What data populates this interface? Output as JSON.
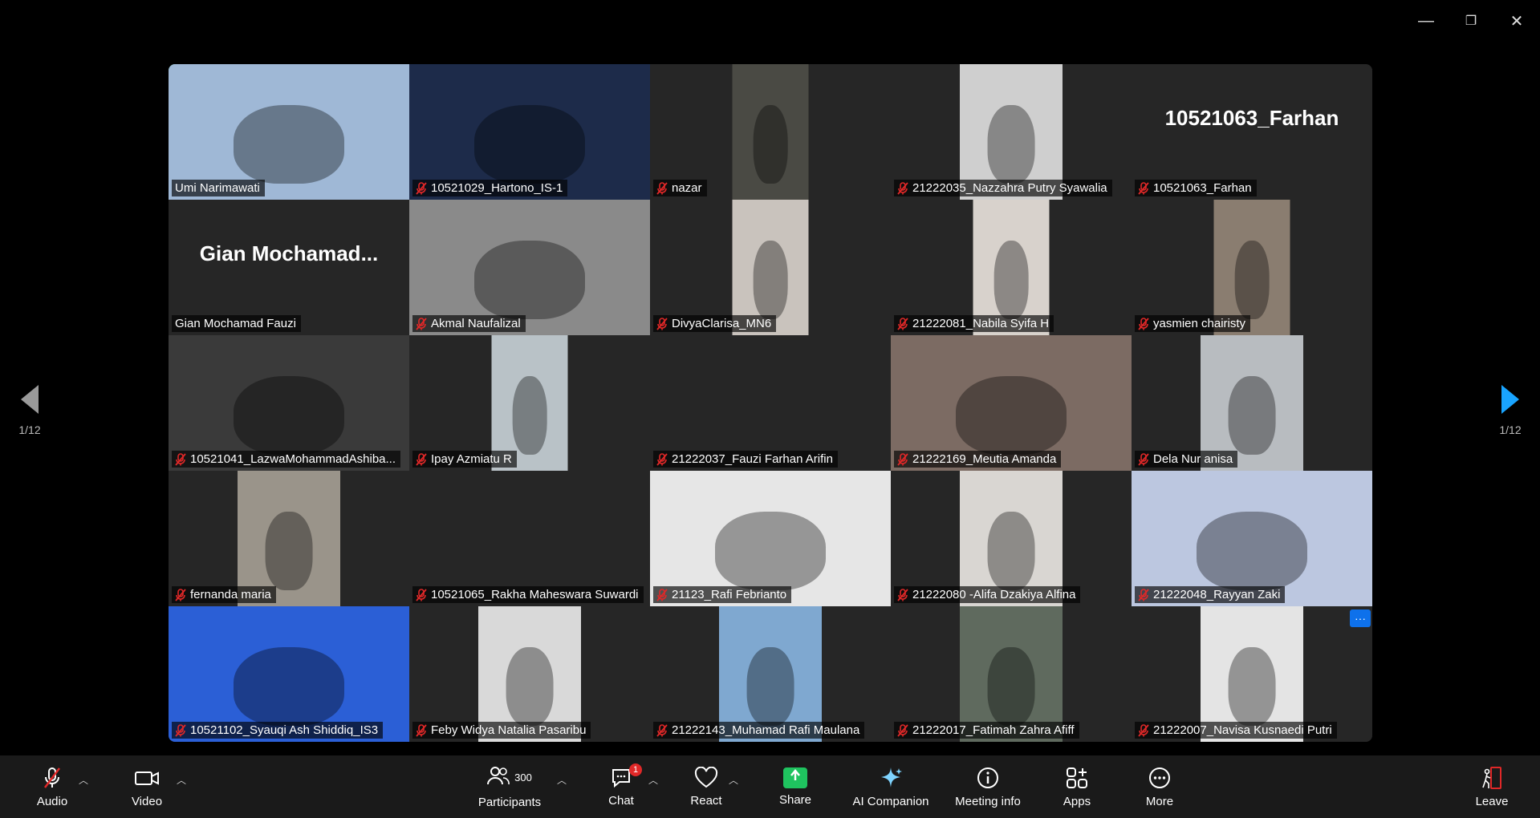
{
  "window": {
    "minimize": "—",
    "restore": "❐",
    "close": "✕"
  },
  "pager": {
    "left": "1/12",
    "right": "1/12"
  },
  "participants": [
    {
      "name": "Umi Narimawati",
      "muted": false,
      "type": "video",
      "active": true,
      "bg": "#9fb8d6",
      "vw": 300
    },
    {
      "name": "10521029_Hartono_IS-1",
      "muted": true,
      "type": "video",
      "bg": "#1d2b4a",
      "vw": 300
    },
    {
      "name": "nazar",
      "muted": true,
      "type": "video",
      "bg": "#4a4a44",
      "vw": 95
    },
    {
      "name": "21222035_Nazzahra Putry Syawalia",
      "muted": true,
      "type": "video",
      "bg": "#cfcfcf",
      "vw": 128
    },
    {
      "name": "10521063_Farhan",
      "muted": true,
      "type": "text",
      "display": "10521063_Farhan"
    },
    {
      "name": "Gian Mochamad Fauzi",
      "muted": false,
      "type": "text",
      "display": "Gian  Mochamad..."
    },
    {
      "name": "Akmal Naufalizal",
      "muted": true,
      "type": "video",
      "bg": "#8a8a8a",
      "vw": 300
    },
    {
      "name": "DivyaClarisa_MN6",
      "muted": true,
      "type": "video",
      "bg": "#c9c3bd",
      "vw": 95
    },
    {
      "name": "21222081_Nabila Syifa H",
      "muted": true,
      "type": "video",
      "bg": "#d8d2cc",
      "vw": 95
    },
    {
      "name": "yasmien chairisty",
      "muted": true,
      "type": "video",
      "bg": "#8a7d70",
      "vw": 95
    },
    {
      "name": "10521041_LazwaMohammadAshiba...",
      "muted": true,
      "type": "video",
      "bg": "#3a3a3a",
      "vw": 300
    },
    {
      "name": "Ipay Azmiatu R",
      "muted": true,
      "type": "video",
      "bg": "#b9c2c7",
      "vw": 95
    },
    {
      "name": "21222037_Fauzi Farhan Arifin",
      "muted": true,
      "type": "empty"
    },
    {
      "name": "21222169_Meutia Amanda",
      "muted": true,
      "type": "video",
      "bg": "#7c6b63",
      "vw": 300
    },
    {
      "name": "Dela Nur anisa",
      "muted": true,
      "type": "video",
      "bg": "#b8bcc0",
      "vw": 128
    },
    {
      "name": "fernanda maria",
      "muted": true,
      "type": "video",
      "bg": "#9a948a",
      "vw": 128
    },
    {
      "name": "10521065_Rakha Maheswara Suwardi",
      "muted": true,
      "type": "empty"
    },
    {
      "name": "21123_Rafi Febrianto",
      "muted": true,
      "type": "video",
      "bg": "#e6e6e6",
      "vw": 300
    },
    {
      "name": "21222080 -Alifa Dzakiya Alfina",
      "muted": true,
      "type": "video",
      "bg": "#d9d6d2",
      "vw": 128
    },
    {
      "name": "21222048_Rayyan Zaki",
      "muted": true,
      "type": "video",
      "bg": "#bcc7e0",
      "vw": 300
    },
    {
      "name": "10521102_Syauqi Ash Shiddiq_IS3",
      "muted": true,
      "type": "video",
      "bg": "#2b5fd6",
      "vw": 300
    },
    {
      "name": "Feby Widya Natalia Pasaribu",
      "muted": true,
      "type": "video",
      "bg": "#d9d9d9",
      "vw": 128
    },
    {
      "name": "21222143_Muhamad Rafi Maulana",
      "muted": true,
      "type": "video",
      "bg": "#7fa8d0",
      "vw": 128
    },
    {
      "name": "21222017_Fatimah Zahra Afiff",
      "muted": true,
      "type": "video",
      "bg": "#5f6a5e",
      "vw": 128
    },
    {
      "name": "21222007_Navisa Kusnaedi Putri",
      "muted": true,
      "type": "video",
      "bg": "#e4e4e4",
      "vw": 128,
      "more": true
    }
  ],
  "toolbar": {
    "audio": "Audio",
    "video": "Video",
    "participants": "Participants",
    "participants_count": "300",
    "chat": "Chat",
    "chat_badge": "1",
    "react": "React",
    "share": "Share",
    "ai": "AI Companion",
    "meeting_info": "Meeting info",
    "apps": "Apps",
    "more": "More",
    "leave": "Leave"
  }
}
